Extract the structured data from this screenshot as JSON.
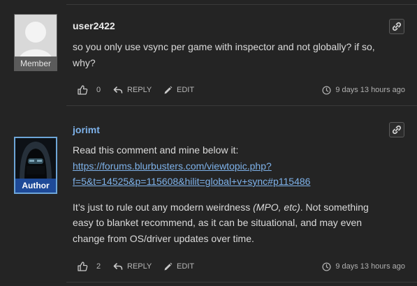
{
  "comments": [
    {
      "username": "user2422",
      "role": "Member",
      "body_line1": "so you only use vsync per game with inspector and not globally? if so,",
      "body_line2": "why?",
      "likes": "0",
      "reply_label": "REPLY",
      "edit_label": "EDIT",
      "timestamp": "9 days 13 hours ago"
    },
    {
      "username": "jorimt",
      "role": "Author",
      "intro": "Read this comment and mine below it:",
      "link_line1": "https://forums.blurbusters.com/viewtopic.php?",
      "link_line2": "f=5&t=14525&p=115608&hilit=global+v+sync#p115486",
      "para_line1_a": "It’s just to rule out any modern weirdness ",
      "para_line1_em": "(MPO, etc)",
      "para_line1_b": ". Not something",
      "para_line2": "easy to blanket recommend, as it can be situational, and may even",
      "para_line3": "change from OS/driver updates over time.",
      "likes": "2",
      "reply_label": "REPLY",
      "edit_label": "EDIT",
      "timestamp": "9 days 13 hours ago"
    }
  ],
  "icons": {
    "like": "thumbs-up-icon",
    "reply": "reply-arrow-icon",
    "edit": "pencil-icon",
    "time": "clock-icon",
    "permalink": "link-icon"
  }
}
